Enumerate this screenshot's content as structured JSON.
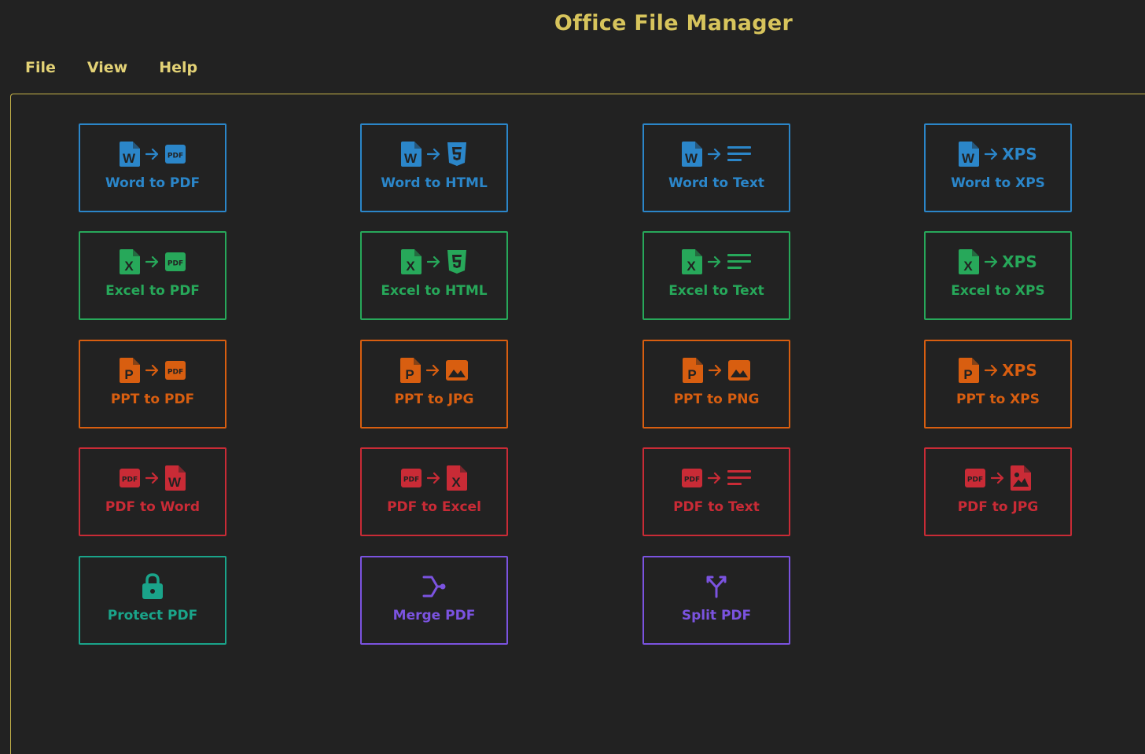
{
  "app": {
    "title": "Office File Manager"
  },
  "menu": [
    "File",
    "View",
    "Help"
  ],
  "colors": {
    "word": "#2b86c9",
    "excel": "#27a85a",
    "ppt": "#d85e10",
    "pdf": "#c92b36",
    "protect": "#1aa48a",
    "merge": "#7b53e0",
    "title": "#d7c45c"
  },
  "tiles": [
    {
      "label": "Word to PDF",
      "theme": "word",
      "from": "word-icon",
      "to": "pdf-icon"
    },
    {
      "label": "Word to HTML",
      "theme": "word",
      "from": "word-icon",
      "to": "html5-icon"
    },
    {
      "label": "Word to Text",
      "theme": "word",
      "from": "word-icon",
      "to": "text-lines-icon"
    },
    {
      "label": "Word to XPS",
      "theme": "word",
      "from": "word-icon",
      "to": "xps-icon"
    },
    {
      "label": "Excel to PDF",
      "theme": "excel",
      "from": "excel-icon",
      "to": "pdf-icon"
    },
    {
      "label": "Excel to HTML",
      "theme": "excel",
      "from": "excel-icon",
      "to": "html5-icon"
    },
    {
      "label": "Excel to Text",
      "theme": "excel",
      "from": "excel-icon",
      "to": "text-lines-icon"
    },
    {
      "label": "Excel to XPS",
      "theme": "excel",
      "from": "excel-icon",
      "to": "xps-icon"
    },
    {
      "label": "PPT to PDF",
      "theme": "ppt",
      "from": "ppt-icon",
      "to": "pdf-icon"
    },
    {
      "label": "PPT to JPG",
      "theme": "ppt",
      "from": "ppt-icon",
      "to": "image-icon"
    },
    {
      "label": "PPT to PNG",
      "theme": "ppt",
      "from": "ppt-icon",
      "to": "image-icon"
    },
    {
      "label": "PPT to XPS",
      "theme": "ppt",
      "from": "ppt-icon",
      "to": "xps-icon"
    },
    {
      "label": "PDF to Word",
      "theme": "pdf",
      "from": "pdf-icon",
      "to": "word-icon"
    },
    {
      "label": "PDF to Excel",
      "theme": "pdf",
      "from": "pdf-icon",
      "to": "excel-icon"
    },
    {
      "label": "PDF to Text",
      "theme": "pdf",
      "from": "pdf-icon",
      "to": "text-lines-icon"
    },
    {
      "label": "PDF to JPG",
      "theme": "pdf",
      "from": "pdf-icon",
      "to": "image-file-icon"
    },
    {
      "label": "Protect PDF",
      "theme": "protect",
      "single": "lock-icon"
    },
    {
      "label": "Merge PDF",
      "theme": "merge",
      "single": "merge-icon"
    },
    {
      "label": "Split PDF",
      "theme": "merge",
      "single": "split-icon"
    }
  ],
  "xps_text": "XPS"
}
